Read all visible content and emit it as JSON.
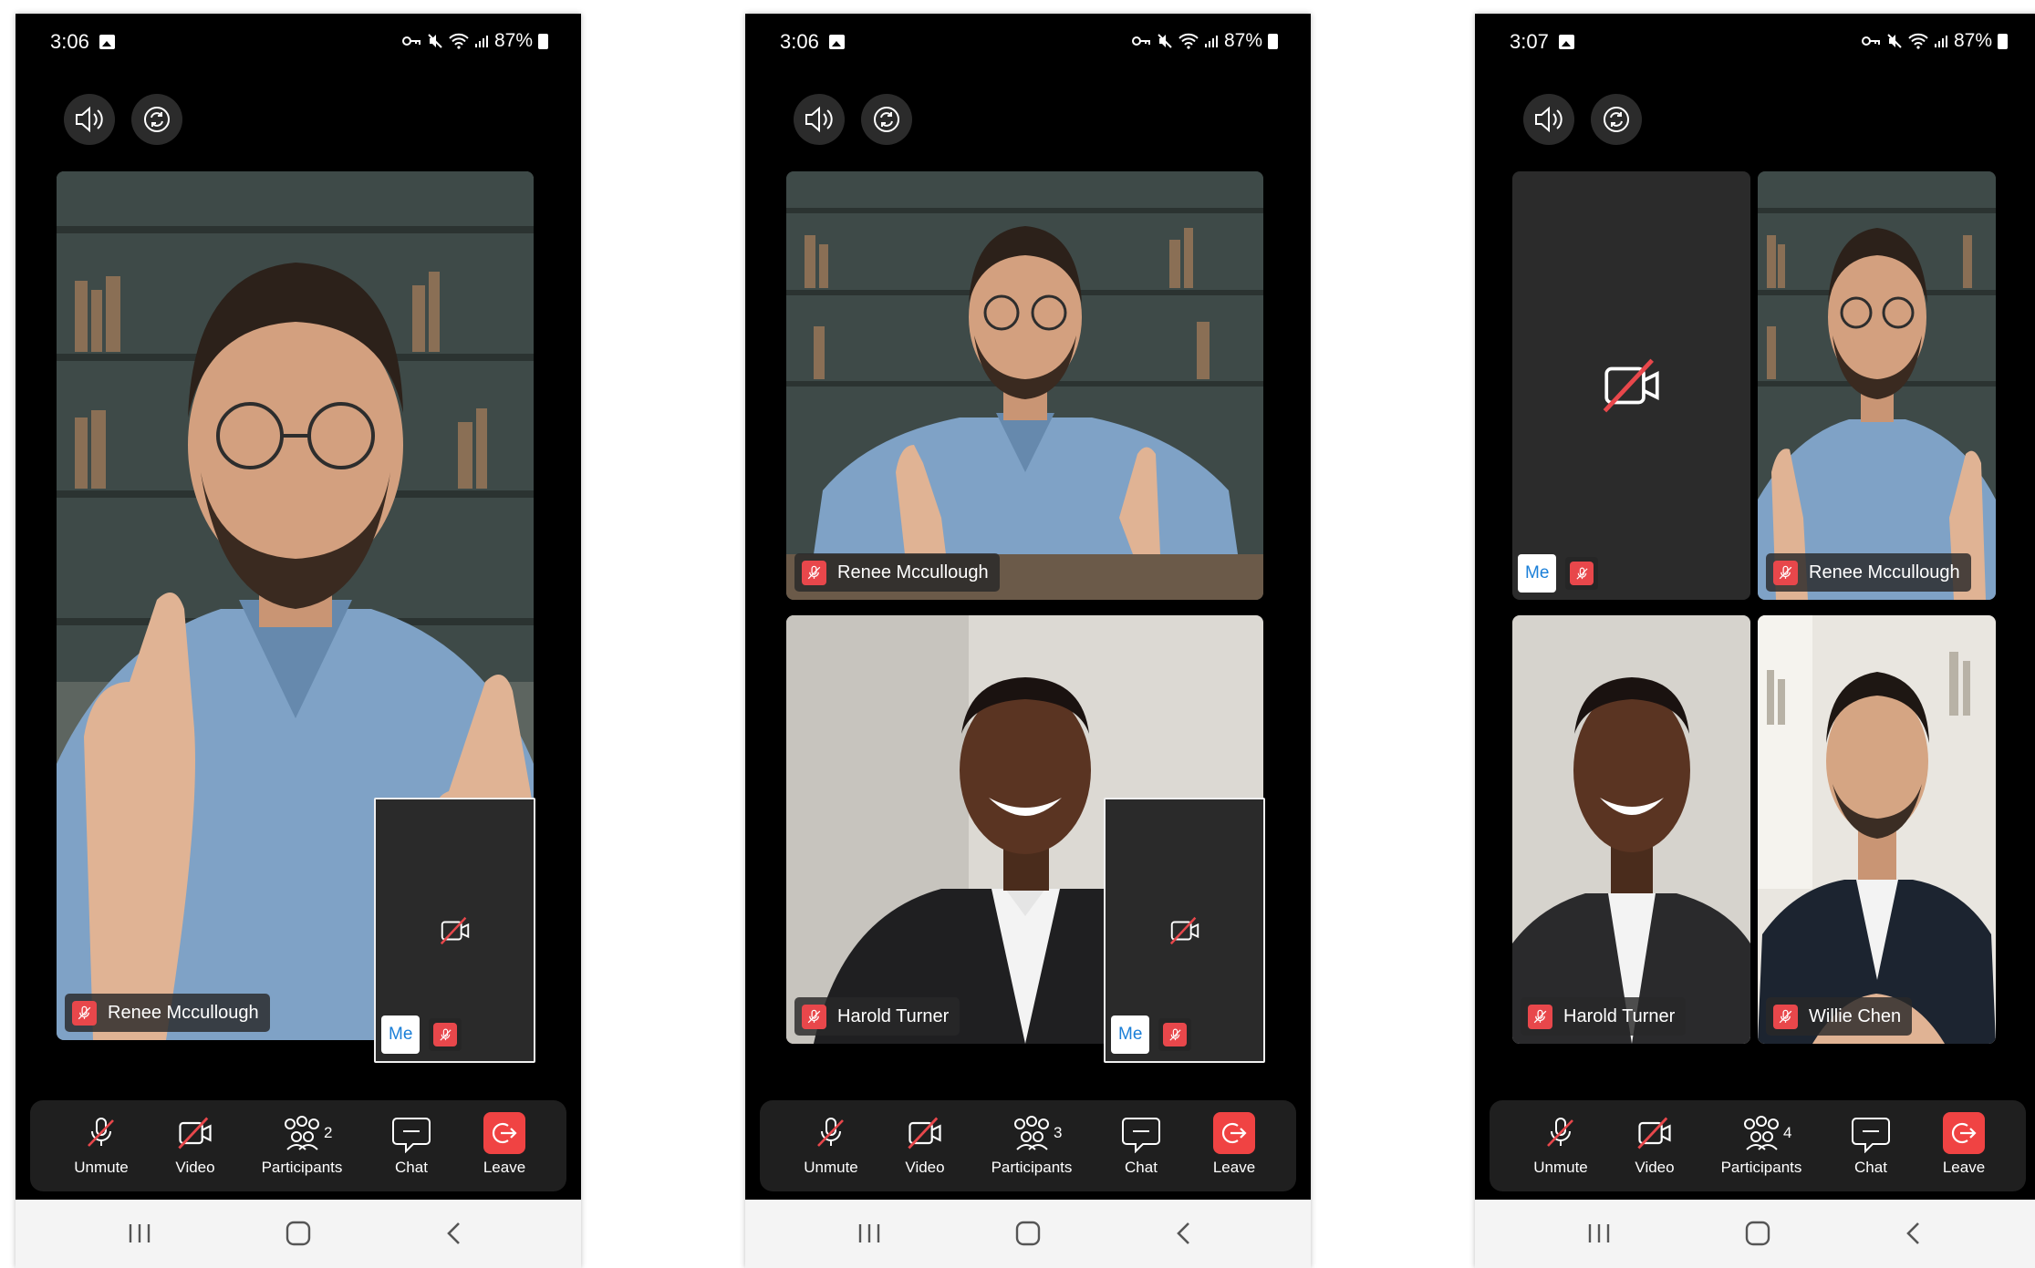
{
  "phones": [
    {
      "status": {
        "time": "3:06",
        "battery": "87%"
      },
      "participant_count": "2",
      "tiles": [
        {
          "name": "Renee Mccullough"
        }
      ],
      "self_view": {
        "me_label": "Me"
      }
    },
    {
      "status": {
        "time": "3:06",
        "battery": "87%"
      },
      "participant_count": "3",
      "tiles": [
        {
          "name": "Renee Mccullough"
        },
        {
          "name": "Harold Turner"
        }
      ],
      "self_view": {
        "me_label": "Me"
      }
    },
    {
      "status": {
        "time": "3:07",
        "battery": "87%"
      },
      "participant_count": "4",
      "tiles": [
        {
          "name": "Renee Mccullough"
        },
        {
          "name": "Harold Turner"
        },
        {
          "name": "Willie Chen"
        }
      ],
      "self_view": {
        "me_label": "Me"
      }
    }
  ],
  "toolbar": {
    "unmute": "Unmute",
    "video": "Video",
    "participants": "Participants",
    "chat": "Chat",
    "leave": "Leave"
  },
  "colors": {
    "accent_red": "#e8474b",
    "leave_red": "#f04343",
    "me_blue": "#1a7fd8",
    "background": "#000000",
    "tile_dark": "#2b2b2b"
  },
  "icons": {
    "top_bar": [
      "speaker-icon",
      "switch-camera-icon"
    ],
    "toolbar": [
      "mic-off-icon",
      "video-off-icon",
      "participants-icon",
      "chat-icon",
      "leave-icon"
    ],
    "nav": [
      "recents-icon",
      "home-icon",
      "back-icon"
    ]
  }
}
